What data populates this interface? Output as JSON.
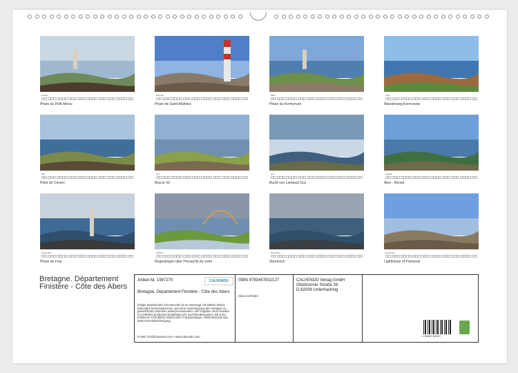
{
  "months": [
    {
      "name": "Januar",
      "caption": "Phare du Petit Minou"
    },
    {
      "name": "Februar",
      "caption": "Phare de Saint-Mathieu"
    },
    {
      "name": "März",
      "caption": "Phare du Kermorvan"
    },
    {
      "name": "April",
      "caption": "Wanderweg Kermorvan"
    },
    {
      "name": "Mai",
      "caption": "Point de Corsen"
    },
    {
      "name": "Juni",
      "caption": "Beg ar Vir"
    },
    {
      "name": "Juli",
      "caption": "Bucht von Lampaul Goz"
    },
    {
      "name": "August",
      "caption": "Aber - Benoit"
    },
    {
      "name": "September",
      "caption": "Phare de Four"
    },
    {
      "name": "Oktober",
      "caption": "Regenbogen über Presqu'île du vivier"
    },
    {
      "name": "November",
      "caption": "Sturmisch"
    },
    {
      "name": "Dezember",
      "caption": "Lighthouse of Portusval"
    }
  ],
  "title": "Bretagne. Département Finistère - Côte des Abers",
  "info": {
    "article": "Artikel-Nr. 1997270",
    "brand": "CALVENDO",
    "subtitle": "Bretagne. Département Finistère - Côte des Abers",
    "legal": "Infolge bestehender Schutzrechte ist es untersagt, die Blätter dieses Kalenders herauszutrennen und ohne Genehmigung des Verlages zu gewerblichen Zwecken weiterzuverwenden. Alle Angaben ohne Gewähr. CALVENDO produziert bedarfsgerecht und klimabewusst in DE & EU. Positivere CO2-Bilanz dank kurzer Transportwege. Abfall-Reduzierung dank Einzelstückfertigung.",
    "email": "E-Mail: info@calvendo.com • www.calvendo.com",
    "isbn": "ISBN 9783457832127",
    "author": "Diana Schröder",
    "publisher1": "CALVENDO Verlag GmbH",
    "publisher2": "Ottobrunner Straße 39",
    "publisher3": "D-82008 Unterhaching",
    "barcode_number": "9 783457 832127"
  },
  "colors": {
    "sky": "#8fb3d9",
    "sea": "#4a78a8",
    "grass": "#7a9a4a",
    "rock": "#6e5a44"
  }
}
